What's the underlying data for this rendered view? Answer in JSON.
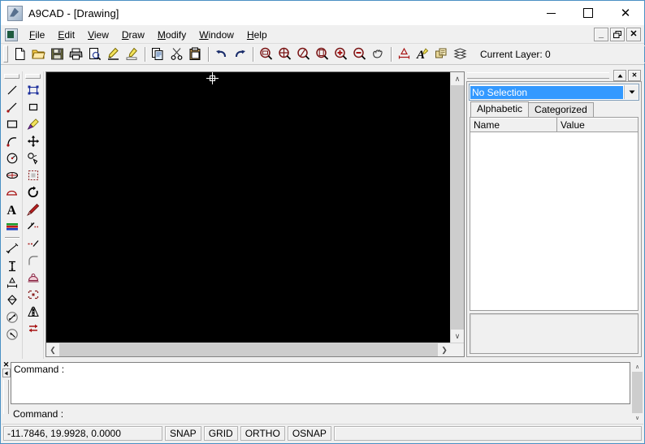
{
  "window": {
    "title": "A9CAD - [Drawing]",
    "app_icon": "a9cad-logo-icon",
    "minimize": "—",
    "maximize": "□",
    "close": "✕"
  },
  "menubar": {
    "mdi_icon": "document-icon",
    "items": [
      {
        "label": "File",
        "mnemonic": "F"
      },
      {
        "label": "Edit",
        "mnemonic": "E"
      },
      {
        "label": "View",
        "mnemonic": "V"
      },
      {
        "label": "Draw",
        "mnemonic": "D"
      },
      {
        "label": "Modify",
        "mnemonic": "M"
      },
      {
        "label": "Window",
        "mnemonic": "W"
      },
      {
        "label": "Help",
        "mnemonic": "H"
      }
    ],
    "mdi_buttons": [
      {
        "name": "mdi-minimize-button",
        "glyph": "_"
      },
      {
        "name": "mdi-restore-button",
        "glyph": "❐"
      },
      {
        "name": "mdi-close-button",
        "glyph": "✕"
      }
    ]
  },
  "toolbar": {
    "groups": [
      [
        "new-file-icon",
        "open-folder-icon",
        "save-disk-icon",
        "print-icon",
        "print-preview-icon",
        "pencil-edit-icon",
        "highlighter-icon"
      ],
      [
        "copy-icon",
        "cut-scissors-icon",
        "paste-clipboard-icon"
      ],
      [
        "undo-arrow-icon",
        "redo-arrow-icon"
      ],
      [
        "zoom-window-icon",
        "zoom-all-icon",
        "zoom-dynamic-icon",
        "zoom-scale-icon",
        "zoom-in-icon",
        "zoom-out-icon",
        "pan-hand-icon"
      ],
      [
        "dimension-style-icon",
        "text-style-icon",
        "layer-properties-icon",
        "layers-icon"
      ]
    ],
    "current_layer_label": "Current Layer: 0"
  },
  "draw_toolbar": {
    "name": "draw-toolbar",
    "tools": [
      "line-icon",
      "polyline-icon",
      "rectangle-icon",
      "arc-icon",
      "circle-icon",
      "ellipse-icon",
      "spline-icon",
      "text-icon",
      "gradient-hatch-icon"
    ],
    "dimension_tools": [
      "dimension-aligned-icon",
      "dimension-vertical-icon",
      "dimension-horizontal-icon",
      "dimension-leader-icon",
      "dimension-angular-icon",
      "dimension-radius-icon"
    ]
  },
  "modify_toolbar": {
    "name": "modify-toolbar",
    "tools": [
      "select-object-icon",
      "deselect-object-icon",
      "match-properties-icon",
      "move-icon",
      "copy-object-icon",
      "array-icon",
      "rotate-icon",
      "erase-icon",
      "trim-icon",
      "extend-icon",
      "fillet-icon",
      "chamfer-icon",
      "explode-icon",
      "mirror-icon",
      "offset-icon"
    ]
  },
  "canvas": {
    "name": "drawing-canvas",
    "background": "#000000",
    "cursor": "crosshair-cursor",
    "h_scroll_left": "❮",
    "h_scroll_right": "❯",
    "v_scroll_up": "∧",
    "v_scroll_down": "∨"
  },
  "properties": {
    "panel_name": "properties-panel",
    "collapse_glyph": "▲",
    "close_glyph": "✕",
    "selection": "No Selection",
    "combo_arrow": "▼",
    "tabs": [
      {
        "label": "Alphabetic",
        "active": true
      },
      {
        "label": "Categorized",
        "active": false
      }
    ],
    "columns": [
      "Name",
      "Value"
    ],
    "rows": []
  },
  "command_window": {
    "name": "command-window",
    "close_glyph": "✕",
    "scroll_glyph": "◂",
    "history": "Command :",
    "prompt": "Command :",
    "scroll_up": "∧",
    "scroll_down": "∨"
  },
  "statusbar": {
    "coordinates": "-11.7846, 19.9928, 0.0000",
    "toggles": [
      {
        "label": "SNAP",
        "name": "status-toggle-snap"
      },
      {
        "label": "GRID",
        "name": "status-toggle-grid"
      },
      {
        "label": "ORTHO",
        "name": "status-toggle-ortho"
      },
      {
        "label": "OSNAP",
        "name": "status-toggle-osnap"
      }
    ]
  },
  "colors": {
    "canvas": "#000000",
    "selection_highlight": "#3399ff",
    "window_border": "#4a90c4",
    "chrome": "#f0f0f0"
  }
}
